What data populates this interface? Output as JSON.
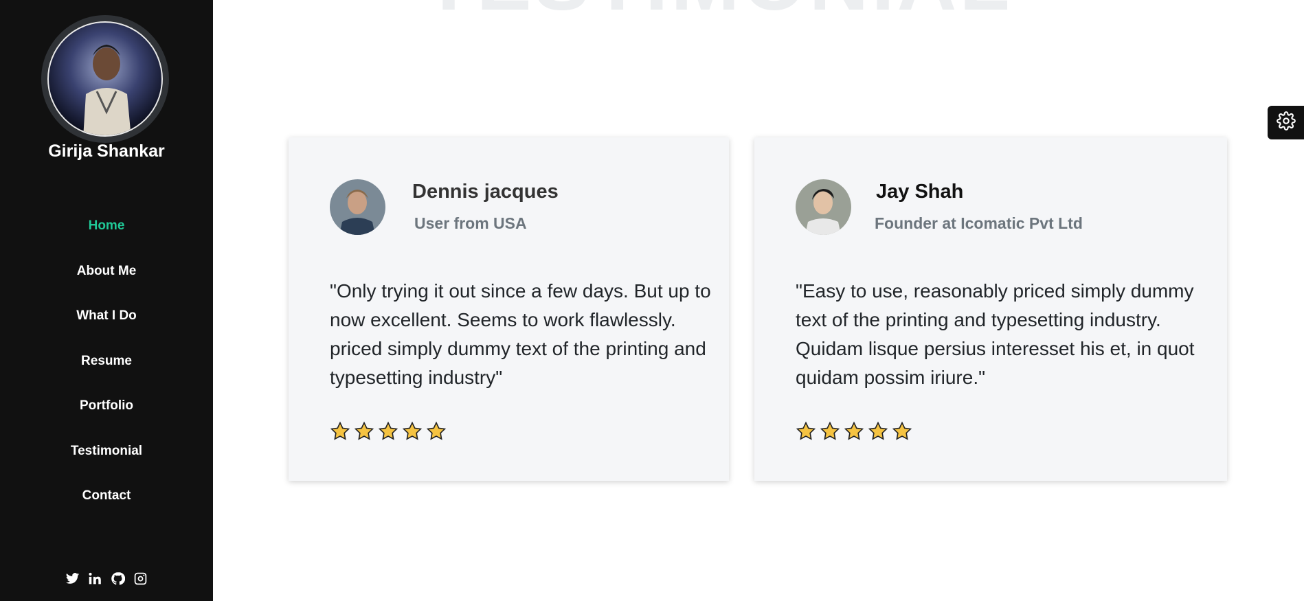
{
  "sidebar": {
    "owner_name": "Girija Shankar",
    "nav": [
      {
        "label": "Home",
        "active": true
      },
      {
        "label": "About Me"
      },
      {
        "label": "What I Do"
      },
      {
        "label": "Resume"
      },
      {
        "label": "Portfolio"
      },
      {
        "label": "Testimonial"
      },
      {
        "label": "Contact"
      }
    ],
    "social_icons": [
      "twitter-icon",
      "linkedin-icon",
      "github-icon",
      "instagram-icon"
    ]
  },
  "main": {
    "background_title": "TESTIMONIAL",
    "testimonials": [
      {
        "name": "Dennis jacques",
        "role": "User from USA",
        "quote": "\"Only trying it out since a few days. But up to now excellent. Seems to work flawlessly. priced simply dummy text of the printing and typesetting industry\"",
        "rating": 5
      },
      {
        "name": "Jay Shah",
        "role": "Founder at Icomatic Pvt Ltd",
        "quote": "\"Easy to use, reasonably priced simply dummy text of the printing and typesetting industry. Quidam lisque persius interesset his et, in quot quidam possim iriure.\"",
        "rating": 5
      }
    ]
  },
  "colors": {
    "sidebar_bg": "#111111",
    "accent": "#20c997",
    "card_bg": "#f5f6f8",
    "star": "#f5c342"
  },
  "settings_icon": "gear-icon"
}
